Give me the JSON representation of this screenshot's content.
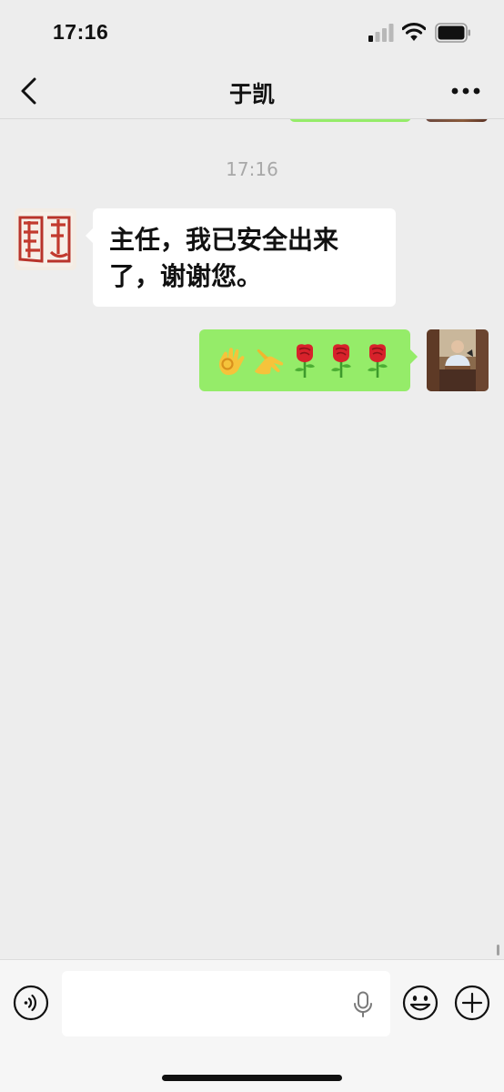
{
  "status_bar": {
    "time": "17:16",
    "signal_icon": "cellular-signal-icon",
    "wifi_icon": "wifi-icon",
    "battery_icon": "battery-icon"
  },
  "nav": {
    "title": "于凯",
    "back_icon": "chevron-left-icon",
    "more_icon": "ellipsis-icon"
  },
  "chat": {
    "timestamp": "17:16",
    "messages": [
      {
        "direction": "incoming",
        "type": "text",
        "text": "主任，我已安全出来了，谢谢您。",
        "avatar": "red-seal-avatar"
      },
      {
        "direction": "outgoing",
        "type": "emoji",
        "emojis": [
          "ok-hand-emoji",
          "pinching-hand-emoji",
          "rose-emoji",
          "rose-emoji",
          "rose-emoji"
        ],
        "avatar": "photo-avatar"
      }
    ]
  },
  "input_bar": {
    "voice_icon": "voice-mode-icon",
    "mic_icon": "microphone-icon",
    "sticker_icon": "smiley-icon",
    "plus_icon": "plus-circle-icon",
    "input_value": ""
  },
  "colors": {
    "background": "#ededed",
    "outgoing_bubble": "#95ec69",
    "incoming_bubble": "#ffffff",
    "timestamp": "#a8a8a8"
  }
}
